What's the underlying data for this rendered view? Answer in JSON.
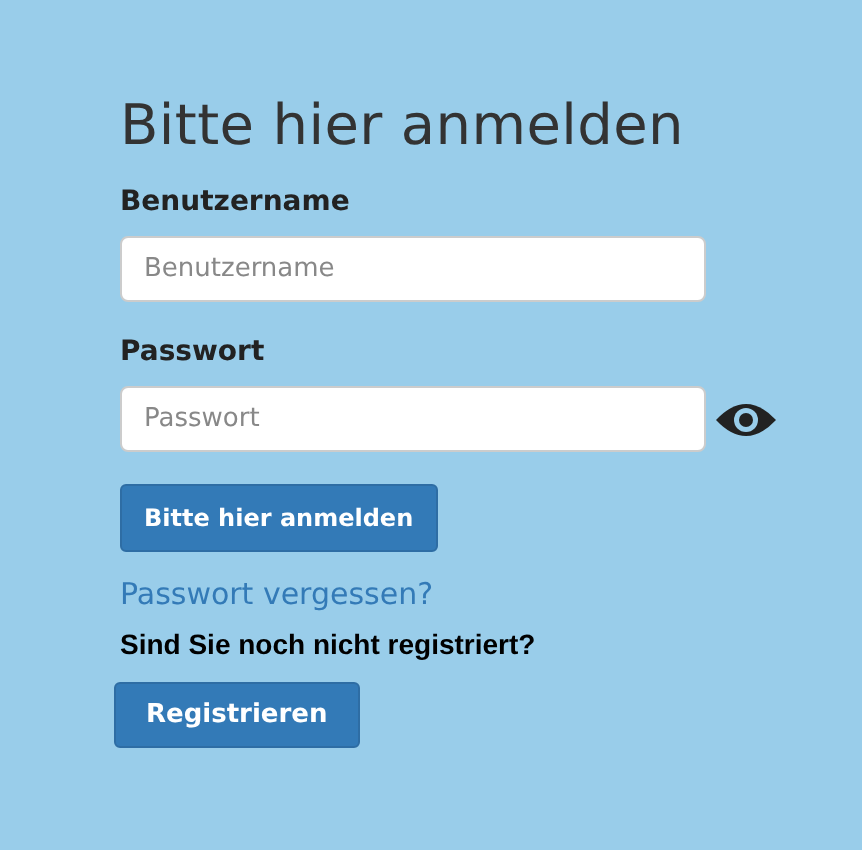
{
  "title": "Bitte hier anmelden",
  "fields": [
    {
      "label": "Benutzername",
      "placeholder": "Benutzername",
      "kind": "text"
    },
    {
      "label": "Passwort",
      "placeholder": "Passwort",
      "kind": "password"
    }
  ],
  "login_button": "Bitte hier anmelden",
  "forgot_link": "Passwort vergessen?",
  "register_prompt": "Sind Sie noch nicht registriert?",
  "register_button": "Registrieren"
}
